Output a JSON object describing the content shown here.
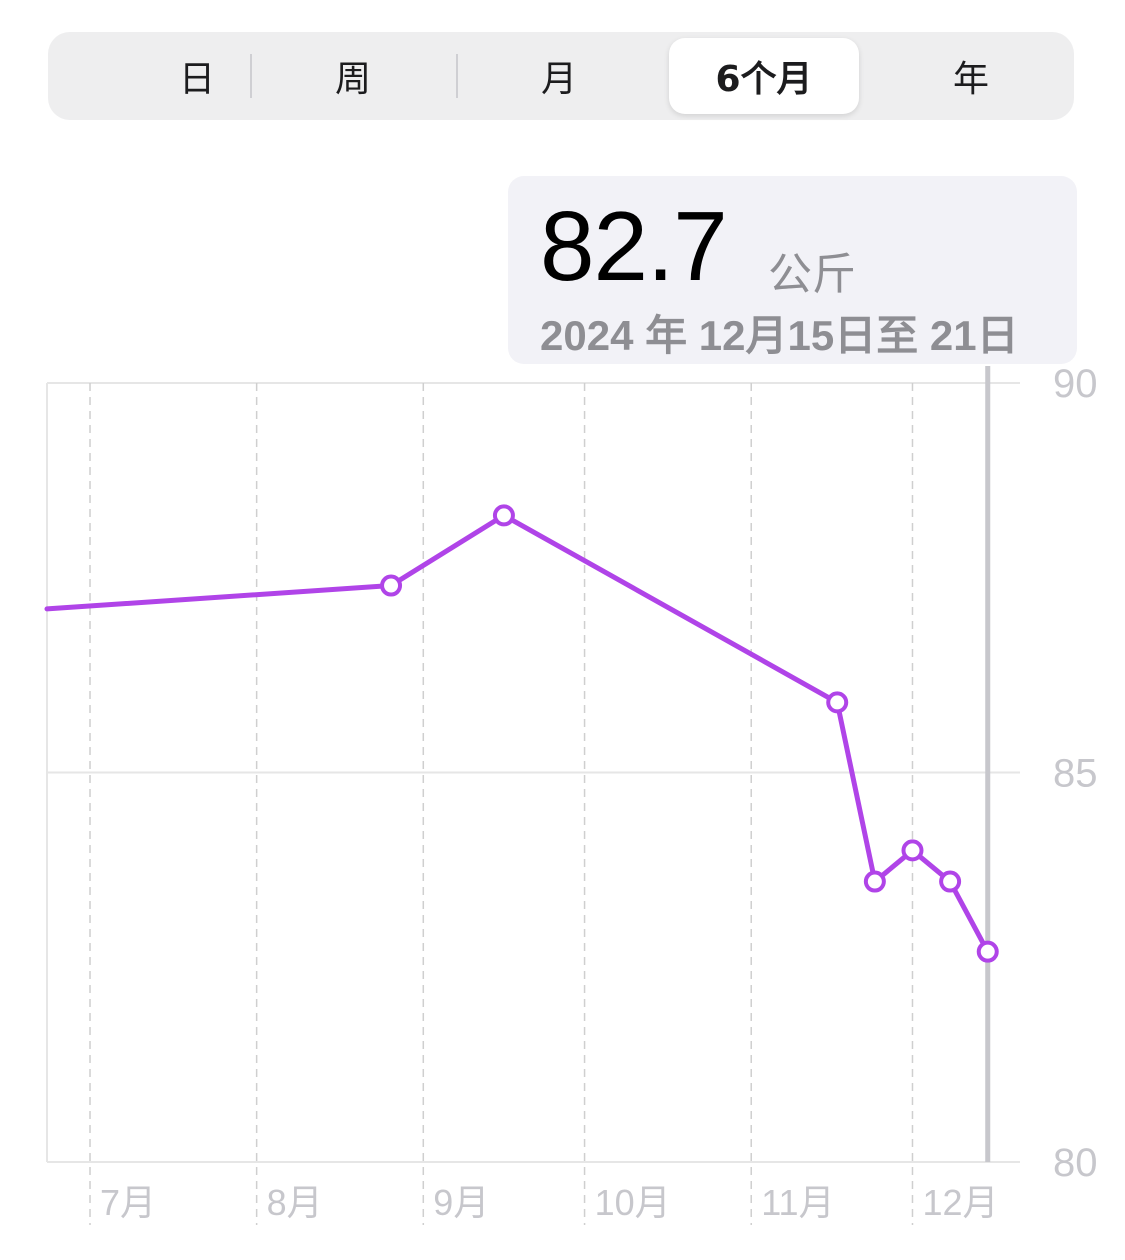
{
  "segments": {
    "items": [
      "日",
      "周",
      "月",
      "6个月",
      "年"
    ],
    "selected": "6个月"
  },
  "callout": {
    "value": "82.7",
    "unit": "公斤",
    "range": "2024 年 12月15日至 21日"
  },
  "colors": {
    "line": "#b044e8",
    "grid": "#e6e6e6",
    "axis_label": "#c7c7cc",
    "selection": "#c7c7cc"
  },
  "chart_data": {
    "type": "line",
    "x_unit": "date",
    "x_tick_labels": [
      "7月",
      "8月",
      "9月",
      "10月",
      "11月",
      "12月"
    ],
    "x_ticks": [
      "2024-07-01",
      "2024-08-01",
      "2024-09-01",
      "2024-10-01",
      "2024-11-01",
      "2024-12-01"
    ],
    "xlim": [
      "2024-06-23",
      "2024-12-21"
    ],
    "y_tick_labels": [
      "90",
      "85",
      "80"
    ],
    "ylim": [
      80,
      90
    ],
    "grid": true,
    "series": [
      {
        "points": [
          {
            "x": "2024-06-23",
            "y": 87.1
          },
          {
            "x": "2024-08-26",
            "y": 87.4
          },
          {
            "x": "2024-09-16",
            "y": 88.3
          },
          {
            "x": "2024-11-17",
            "y": 85.9
          },
          {
            "x": "2024-11-24",
            "y": 83.6
          },
          {
            "x": "2024-12-01",
            "y": 84.0
          },
          {
            "x": "2024-12-08",
            "y": 83.6
          },
          {
            "x": "2024-12-15",
            "y": 82.7
          }
        ]
      }
    ],
    "selected_x": "2024-12-15"
  }
}
